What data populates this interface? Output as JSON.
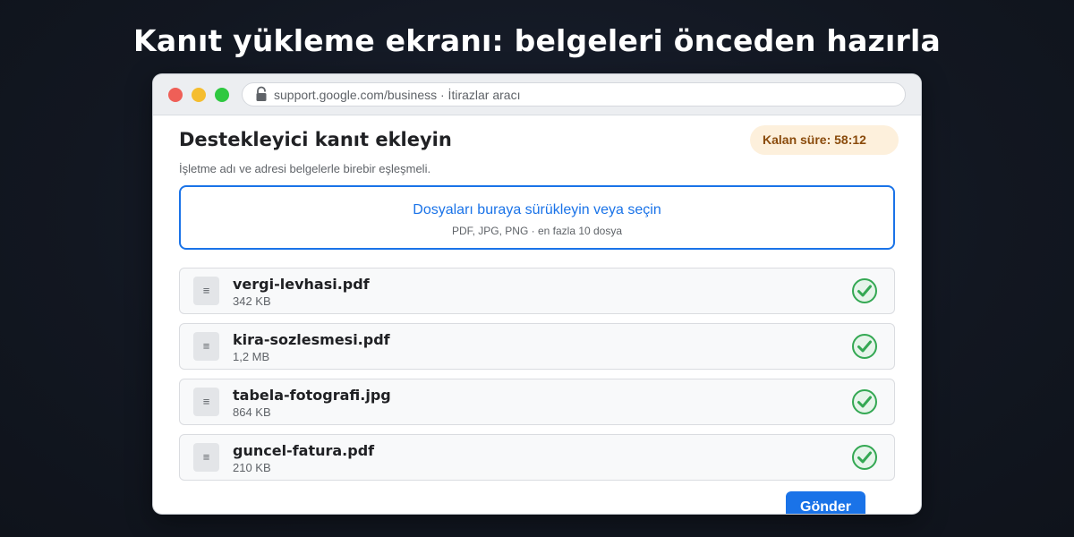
{
  "headline": "Kanıt yükleme ekranı: belgeleri önceden hazırla",
  "browser": {
    "url": "support.google.com/business · İtirazlar aracı"
  },
  "page": {
    "title": "Destekleyici kanıt ekleyin",
    "subtitle": "İşletme adı ve adresi belgelerle birebir eşleşmeli.",
    "timer": "Kalan süre: 58:12"
  },
  "dropzone": {
    "title": "Dosyaları buraya sürükleyin veya seçin",
    "hint": "PDF, JPG, PNG · en fazla 10 dosya"
  },
  "files": [
    {
      "name": "vergi-levhasi.pdf",
      "size": "342 KB",
      "icon": "document-icon",
      "status": "uploaded",
      "status_icon": "check-circle-icon"
    },
    {
      "name": "kira-sozlesmesi.pdf",
      "size": "1,2 MB",
      "icon": "document-icon",
      "status": "uploaded",
      "status_icon": "check-circle-icon"
    },
    {
      "name": "tabela-fotografi.jpg",
      "size": "864 KB",
      "icon": "document-icon",
      "status": "uploaded",
      "status_icon": "check-circle-icon"
    },
    {
      "name": "guncel-fatura.pdf",
      "size": "210 KB",
      "icon": "document-icon",
      "status": "uploaded",
      "status_icon": "check-circle-icon"
    }
  ],
  "actions": {
    "submit_label": "Gönder"
  },
  "colors": {
    "accent": "#1a73e8",
    "success": "#34a853",
    "timer_bg": "#fdf0dc",
    "timer_text": "#8a4b0c",
    "page_bg": "#121721"
  }
}
